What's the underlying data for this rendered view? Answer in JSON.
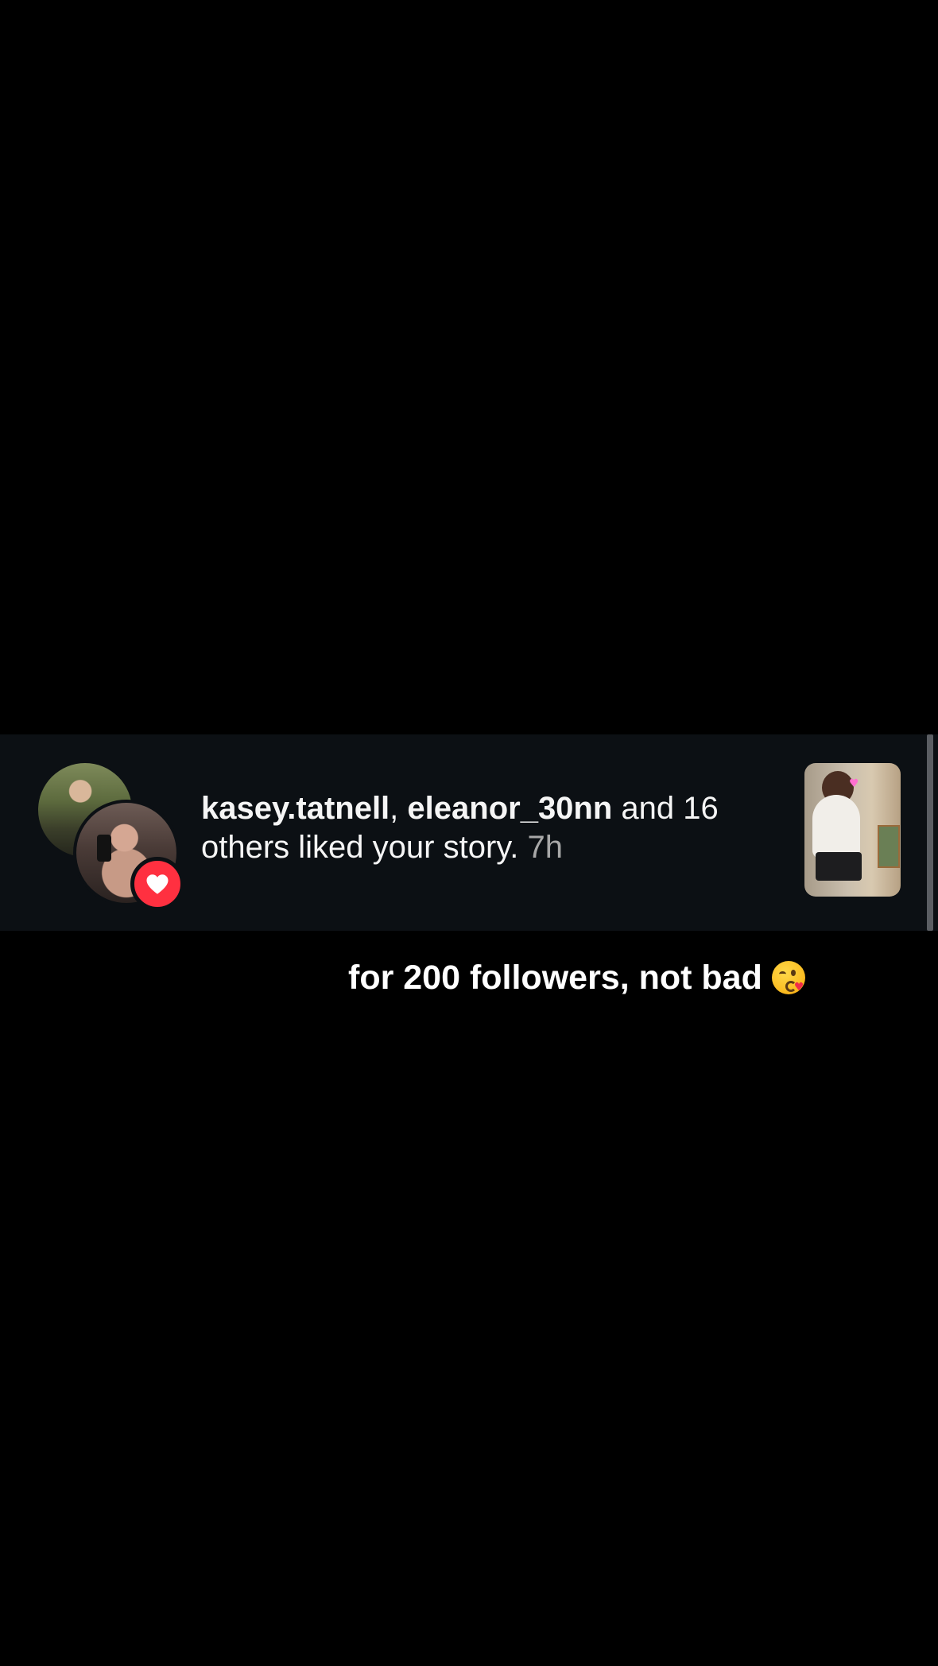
{
  "notification": {
    "user1": "kasey.tatnell",
    "separator": ", ",
    "user2": "eleanor_30nn",
    "message": " and 16 others liked your story. ",
    "time": "7h",
    "badge_icon": "heart-icon"
  },
  "caption": {
    "text": "for 200 followers, not bad",
    "emoji": "kissing-face-emoji"
  },
  "colors": {
    "background": "#000000",
    "card": "#0c1014",
    "heart": "#ff3040",
    "text_primary": "#f5f5f5",
    "text_secondary": "#a8a8a8"
  }
}
